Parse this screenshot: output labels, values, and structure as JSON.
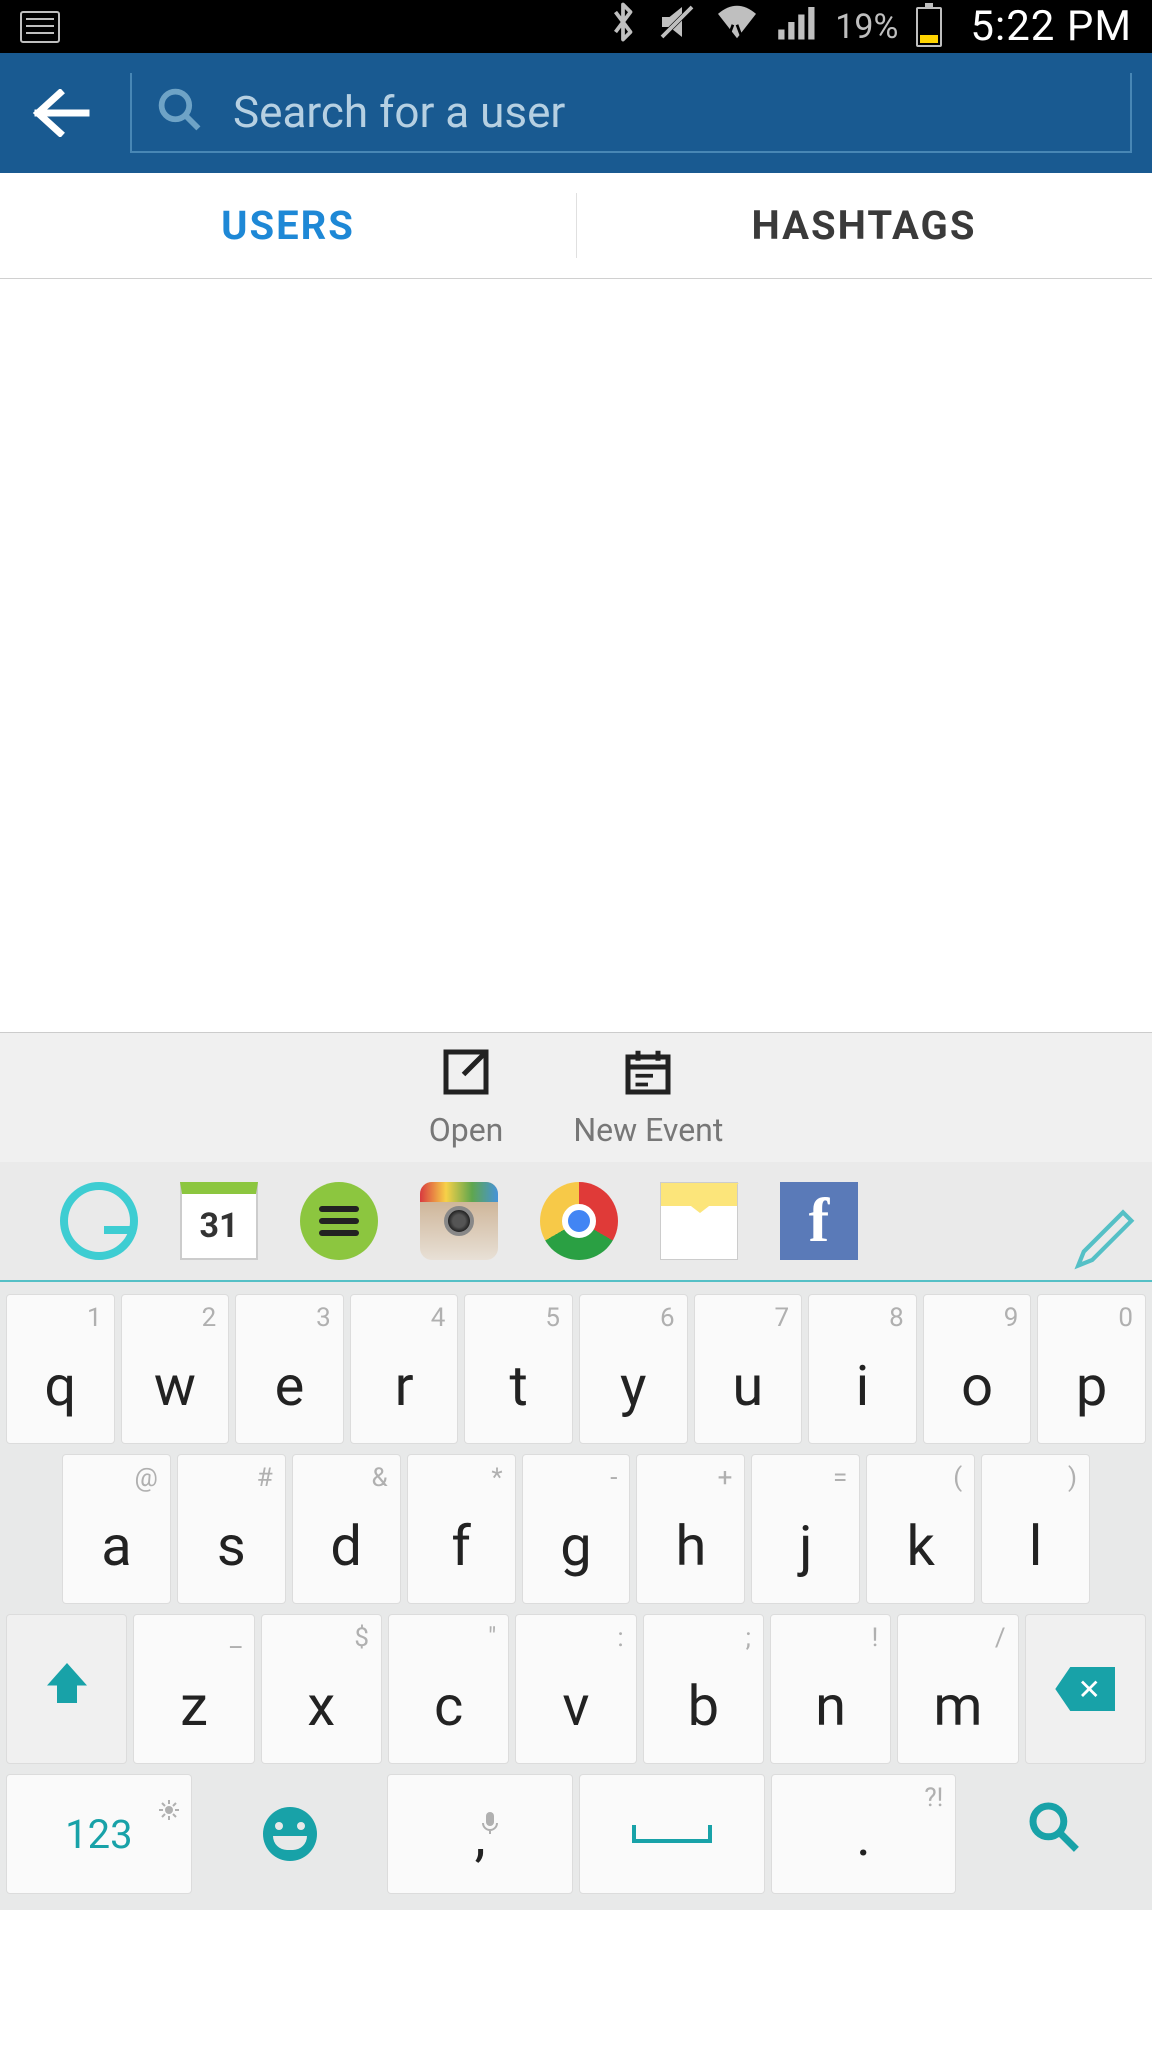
{
  "status": {
    "battery_pct": "19%",
    "time": "5:22 PM"
  },
  "header": {
    "search_placeholder": "Search for a user"
  },
  "tabs": {
    "users": "USERS",
    "hashtags": "HASHTAGS",
    "active": "users"
  },
  "actions": {
    "open": "Open",
    "new_event": "New Event"
  },
  "apps": {
    "grammarly": "G",
    "calendar_day": "31",
    "spotify": "spotify",
    "instagram": "instagram",
    "chrome": "chrome",
    "mail": "mail",
    "facebook": "f"
  },
  "keyboard": {
    "row1": [
      {
        "main": "q",
        "sec": "1"
      },
      {
        "main": "w",
        "sec": "2"
      },
      {
        "main": "e",
        "sec": "3"
      },
      {
        "main": "r",
        "sec": "4"
      },
      {
        "main": "t",
        "sec": "5"
      },
      {
        "main": "y",
        "sec": "6"
      },
      {
        "main": "u",
        "sec": "7"
      },
      {
        "main": "i",
        "sec": "8"
      },
      {
        "main": "o",
        "sec": "9"
      },
      {
        "main": "p",
        "sec": "0"
      }
    ],
    "row2": [
      {
        "main": "a",
        "sec": "@"
      },
      {
        "main": "s",
        "sec": "#"
      },
      {
        "main": "d",
        "sec": "&"
      },
      {
        "main": "f",
        "sec": "*"
      },
      {
        "main": "g",
        "sec": "-"
      },
      {
        "main": "h",
        "sec": "+"
      },
      {
        "main": "j",
        "sec": "="
      },
      {
        "main": "k",
        "sec": "("
      },
      {
        "main": "l",
        "sec": ")"
      }
    ],
    "row3": [
      {
        "main": "z",
        "sec": "_"
      },
      {
        "main": "x",
        "sec": "$"
      },
      {
        "main": "c",
        "sec": "\""
      },
      {
        "main": "v",
        "sec": ":"
      },
      {
        "main": "b",
        "sec": ";"
      },
      {
        "main": "n",
        "sec": "!"
      },
      {
        "main": "m",
        "sec": "/"
      }
    ],
    "row4": {
      "numlock": "123",
      "comma": ",",
      "period": ".",
      "punct_hint": "?!"
    }
  }
}
